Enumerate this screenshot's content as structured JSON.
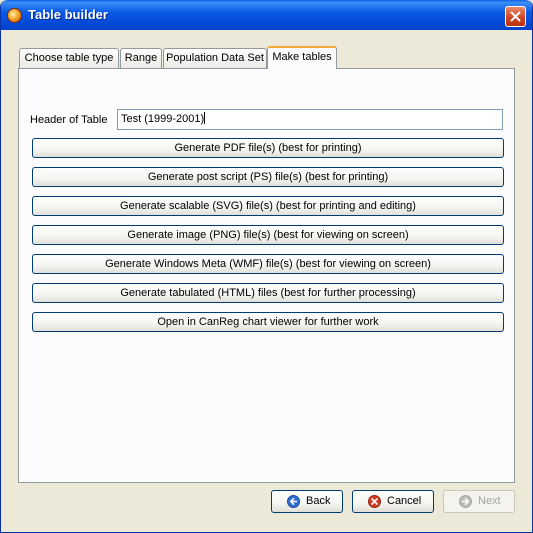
{
  "window": {
    "title": "Table builder"
  },
  "tabs": [
    {
      "label": "Choose table type"
    },
    {
      "label": "Range"
    },
    {
      "label": "Population Data Set"
    },
    {
      "label": "Make tables"
    }
  ],
  "active_tab": "Make tables",
  "header": {
    "label": "Header of Table",
    "value": "Test (1999-2001)"
  },
  "actions": [
    {
      "label": "Generate PDF file(s) (best for printing)"
    },
    {
      "label": "Generate post script (PS) file(s) (best for printing)"
    },
    {
      "label": "Generate scalable (SVG) file(s) (best for printing and editing)"
    },
    {
      "label": "Generate image (PNG) file(s) (best for viewing on screen)"
    },
    {
      "label": "Generate Windows Meta (WMF) file(s) (best for viewing on screen)"
    },
    {
      "label": "Generate tabulated (HTML) files (best for further processing)"
    },
    {
      "label": "Open in CanReg chart viewer for further work"
    }
  ],
  "navigation": {
    "back_label": "Back",
    "cancel_label": "Cancel",
    "next_label": "Next"
  },
  "colors": {
    "titlebar": "#0a5be6",
    "active_tab_accent": "#f1a836",
    "button_border": "#003c74",
    "back_icon": "#2f6fd0",
    "cancel_icon": "#d23a1f"
  }
}
